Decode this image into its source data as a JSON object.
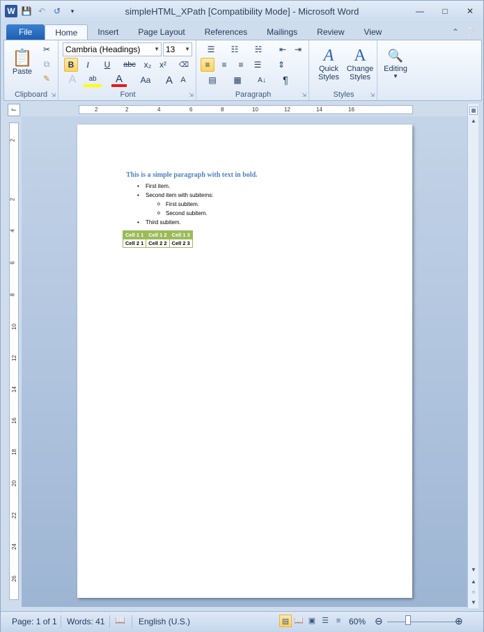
{
  "window": {
    "title": "simpleHTML_XPath [Compatibility Mode]  -  Microsoft Word",
    "app_icon_letter": "W"
  },
  "tabs": [
    "File",
    "Home",
    "Insert",
    "Page Layout",
    "References",
    "Mailings",
    "Review",
    "View"
  ],
  "active_tab": "Home",
  "ribbon": {
    "clipboard": {
      "label": "Clipboard",
      "paste": "Paste"
    },
    "font": {
      "label": "Font",
      "font_name": "Cambria (Headings)",
      "font_size": "13",
      "bold": "B",
      "italic": "I",
      "underline": "U",
      "strike": "abc",
      "subscript": "x₂",
      "superscript": "x²",
      "change_case": "Aa",
      "grow": "A",
      "shrink": "A"
    },
    "paragraph": {
      "label": "Paragraph",
      "show_marks": "¶"
    },
    "styles": {
      "label": "Styles",
      "quick_styles": "Quick\nStyles",
      "quick_1": "Quick",
      "quick_2": "Styles",
      "change_1": "Change",
      "change_2": "Styles"
    },
    "editing": {
      "label": "Editing"
    }
  },
  "ruler": {
    "top_numbers": [
      "2",
      "2",
      "4",
      "6",
      "8",
      "10",
      "12",
      "14",
      "16"
    ],
    "left_numbers": [
      "2",
      "2",
      "4",
      "6",
      "8",
      "10",
      "12",
      "14",
      "16",
      "18",
      "20",
      "22",
      "24",
      "26"
    ]
  },
  "document": {
    "heading": "This is a simple paragraph  with text in bold.",
    "items": [
      "First item.",
      "Second item with subitems:"
    ],
    "subitems": [
      "First subitem.",
      "Second subitem."
    ],
    "last_item": "Third subitem.",
    "table": {
      "header": [
        "Cell 1 1",
        "Cell 1 2",
        "Cell 1 3"
      ],
      "row": [
        "Cell 2 1",
        "Cell 2 2",
        "Cell 2 3"
      ]
    }
  },
  "status": {
    "page": "Page: 1 of 1",
    "words": "Words: 41",
    "language": "English (U.S.)",
    "zoom": "60%",
    "zoom_level": 0.6
  },
  "colors": {
    "accent": "#4f81bd",
    "table_header": "#9bbb59",
    "file_tab": "#2b65b8"
  }
}
